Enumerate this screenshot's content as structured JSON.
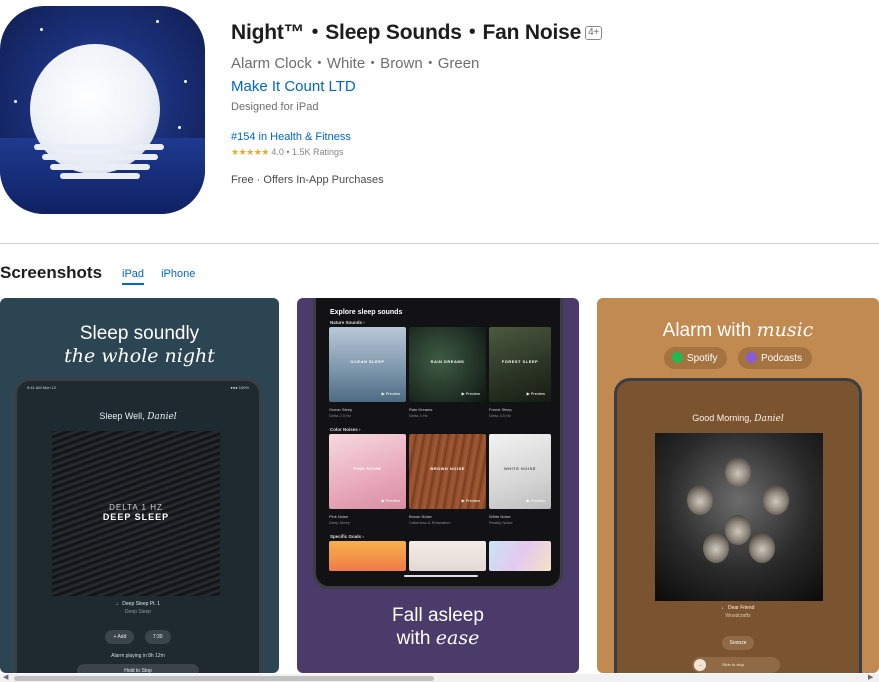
{
  "app": {
    "title": "Night™・Sleep Sounds・Fan Noise",
    "age_rating": "4+",
    "subtitle": "Alarm Clock・White・Brown・Green",
    "developer": "Make It Count LTD",
    "designed_for": "Designed for iPad",
    "rank": "#154 in Health & Fitness",
    "stars": "★★★★★",
    "rating_text": "4.0 • 1.5K Ratings",
    "price": "Free · Offers In-App Purchases"
  },
  "screenshots": {
    "heading": "Screenshots",
    "tabs": [
      {
        "label": "iPad",
        "active": true
      },
      {
        "label": "iPhone",
        "active": false
      }
    ],
    "shot1": {
      "caption_line1": "Sleep soundly",
      "caption_line2": "the whole night",
      "status_left": "9:41 AM  Mon 12",
      "status_right": "●●● 100%",
      "greeting": "Sleep Well, ",
      "greeting_name": "Daniel",
      "art_line1": "DELTA 1 HZ",
      "art_line2": "DEEP SLEEP",
      "track": "♩ Deep Sleep Pt. 1",
      "track_sub": "Deep Sleep",
      "btn_add": "+ Add",
      "btn_time": "7:30",
      "alarm": "Alarm playing in 8h 12m",
      "hold": "Hold to Stop"
    },
    "shot2": {
      "header": "Explore sleep sounds",
      "sections": [
        "Nature Sounds ›",
        "Color Noises ›",
        "Specific Goals ›"
      ],
      "nature": [
        {
          "name": "OCEAN SLEEP",
          "caption": "Ocean Sleep",
          "sub": "Delta 2.5 Hz"
        },
        {
          "name": "RAIN DREAMS",
          "caption": "Rain Dreams",
          "sub": "Delta 4 Hz"
        },
        {
          "name": "FOREST SLEEP",
          "caption": "Forest Sleep",
          "sub": "Delta 3.5 Hz"
        }
      ],
      "colors": [
        {
          "name": "PINK NOISE",
          "caption": "Pink Noise",
          "sub": "Deep Sleep"
        },
        {
          "name": "BROWN NOISE",
          "caption": "Brown Noise",
          "sub": "Calmness & Relaxation"
        },
        {
          "name": "WHITE NOISE",
          "caption": "White Noise",
          "sub": "Reality Noise"
        }
      ],
      "preview": "▶ Preview",
      "caption_line1": "Fall asleep",
      "caption_line2_plain": "with ",
      "caption_line2_italic": "ease"
    },
    "shot3": {
      "caption_plain": "Alarm with ",
      "caption_italic": "music",
      "badge1": "Spotify",
      "badge2": "Podcasts",
      "greeting": "Good Morning, ",
      "greeting_name": "Daniel",
      "track": "♩ Dear Friend",
      "track_sub": "Woodcrafts",
      "snooze": "Snooze",
      "slide": "Slide to stop",
      "slide_icon": "→"
    }
  },
  "colors": {
    "link": "#0066cc",
    "star": "#f5a623",
    "shot1_bg": "#2b4552",
    "shot2_bg": "#4a3b6b",
    "shot3_bg": "#c08a50"
  },
  "icons": {
    "app_icon": "moon-over-water-icon",
    "scroll_left": "◀",
    "scroll_right": "▶"
  }
}
